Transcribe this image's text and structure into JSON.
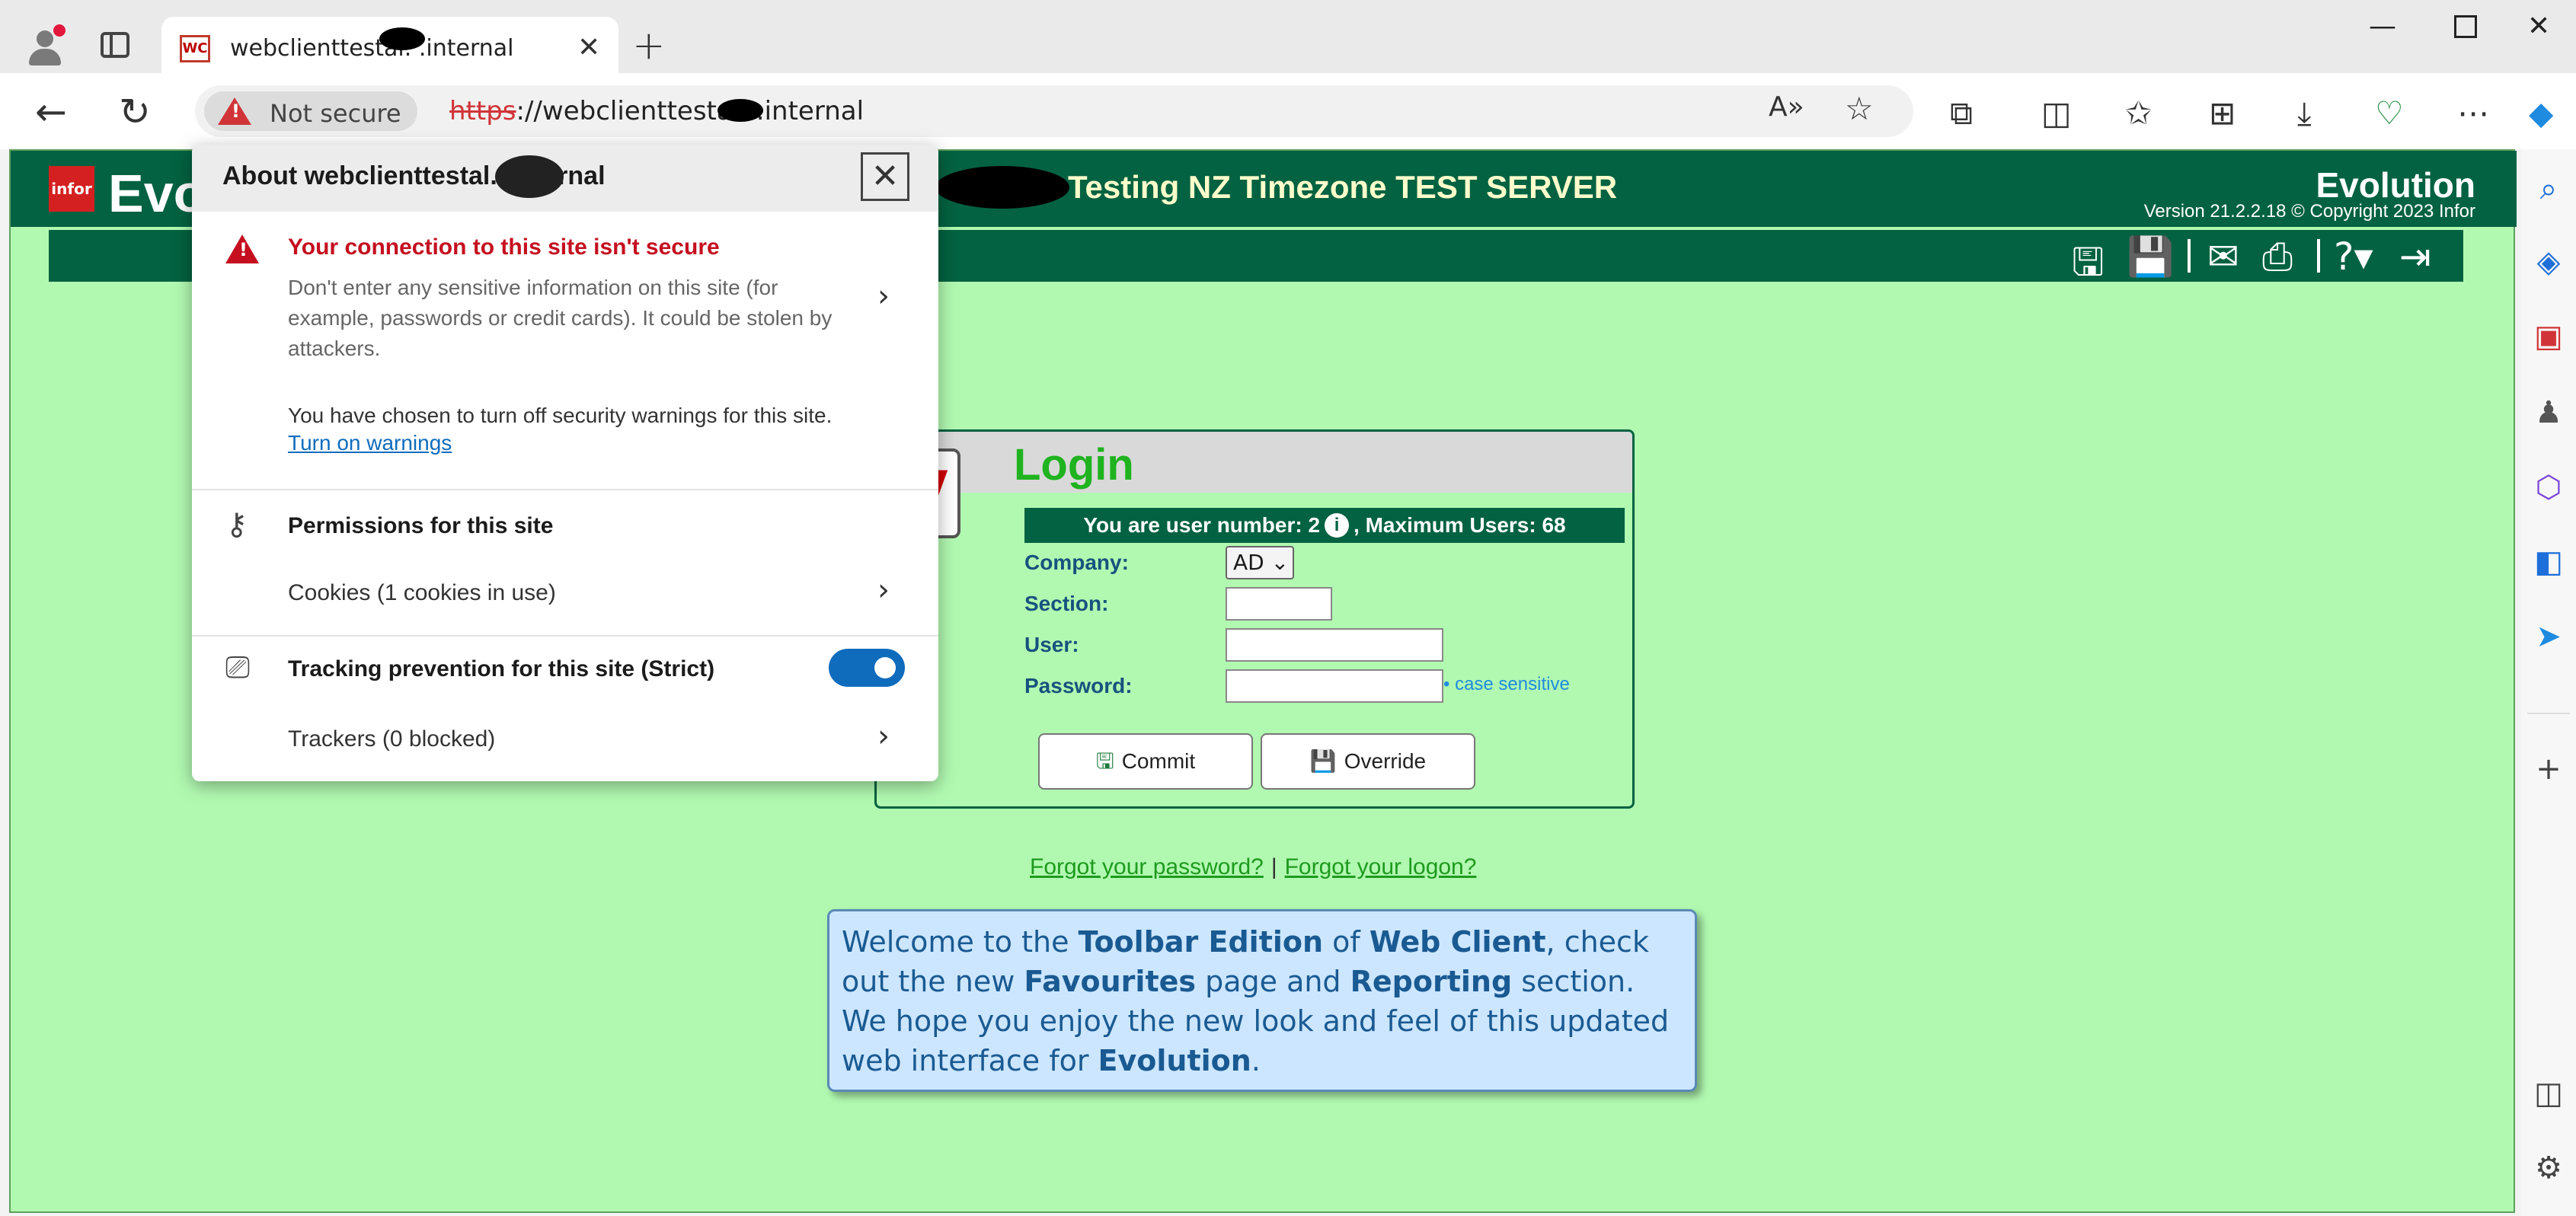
{
  "browser": {
    "tab_title": "webclienttestal.   .internal",
    "tab_favicon": "WC",
    "not_secure_label": "Not secure",
    "url_scheme": "https",
    "url_rest": "://webclienttestal.   .internal",
    "icons": {
      "back": "back-arrow-icon",
      "refresh": "refresh-icon",
      "read_aloud": "read-aloud-icon",
      "favorite": "star-icon",
      "extensions": "puzzle-icon",
      "split": "split-screen-icon",
      "favorites": "favorites-icon",
      "collections": "collections-icon",
      "downloads": "download-icon",
      "health": "heart-pulse-icon",
      "more": "more-icon"
    }
  },
  "app": {
    "logo_text": "infor",
    "logo_word": "Evo",
    "server_title": "Testing NZ Timezone TEST SERVER",
    "brand": "Evolution",
    "version": "Version 21.2.2.18 © Copyright 2023 Infor"
  },
  "login": {
    "title": "Login",
    "logo_letter": "V",
    "user_banner_prefix": "You are user number: 2",
    "user_banner_suffix": ", Maximum Users: 68",
    "fields": {
      "company_label": "Company:",
      "company_value": "AD",
      "section_label": "Section:",
      "user_label": "User:",
      "password_label": "Password:",
      "case_note": "• case sensitive"
    },
    "commit_label": "Commit",
    "override_label": "Override"
  },
  "links": {
    "forgot_password": "Forgot your password?",
    "separator": "|",
    "forgot_logon": "Forgot your logon?"
  },
  "welcome": {
    "t1": "Welcome to the ",
    "b1": "Toolbar Edition",
    "t2": " of ",
    "b2": "Web Client",
    "t3": ", check out the new ",
    "b3": "Favourites",
    "t4": " page and ",
    "b4": "Reporting",
    "t5": " section. We hope you enjoy the new look and feel of this updated web interface for ",
    "b5": "Evolution",
    "t6": "."
  },
  "popup": {
    "title": "About webclienttestal.   .internal",
    "warning_title": "Your connection to this site isn't secure",
    "warning_body": "Don't enter any sensitive information on this site (for example, passwords or credit cards). It could be stolen by attackers.",
    "chosen_text": "You have chosen to turn off security warnings for this site.",
    "turn_on_link": "Turn on warnings",
    "permissions_title": "Permissions for this site",
    "cookies_item": "Cookies (1 cookies in use)",
    "tracking_title": "Tracking prevention for this site (Strict)",
    "trackers_item": "Trackers (0 blocked)",
    "tracking_enabled": true
  },
  "colors": {
    "page_bg": "#b1f9b1",
    "header_green": "#036241",
    "warning_red": "#c50f1f",
    "link_blue": "#0f6cbd",
    "welcome_bg": "#cce6ff"
  }
}
